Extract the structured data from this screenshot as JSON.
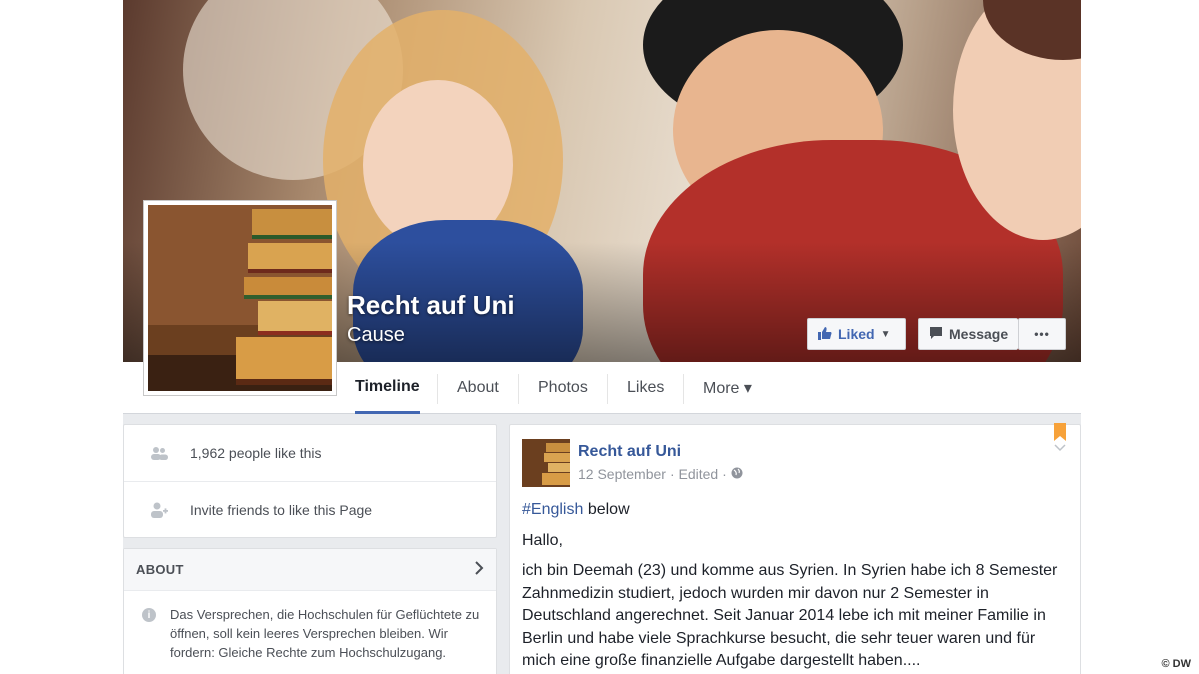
{
  "page": {
    "name": "Recht auf Uni",
    "category": "Cause"
  },
  "cover_actions": {
    "liked_label": "Liked",
    "message_label": "Message",
    "more_label": "•••"
  },
  "tabs": [
    {
      "label": "Timeline",
      "active": true
    },
    {
      "label": "About"
    },
    {
      "label": "Photos"
    },
    {
      "label": "Likes"
    },
    {
      "label": "More ▾"
    }
  ],
  "sidebar": {
    "likes_count": "1,962 people like this",
    "invite_text": "Invite friends to like this Page",
    "about_heading": "ABOUT",
    "about_text": "Das Versprechen, die Hochschulen für Geflüchtete zu öffnen, soll kein leeres Versprechen bleiben. Wir fordern: Gleiche Rechte zum Hochschulzugang."
  },
  "post": {
    "author": "Recht auf Uni",
    "date": "12 September",
    "edited": "· Edited ·",
    "hashtag": "#English",
    "hashtag_suffix": " below",
    "greeting": "Hallo,",
    "text": "ich bin Deemah (23) und komme aus Syrien. In Syrien habe ich 8 Semester Zahnmedizin studiert, jedoch wurden mir davon nur 2 Semester in Deutschland angerechnet. Seit Januar 2014 lebe ich mit meiner Familie in Berlin und habe viele Sprachkurse besucht, die sehr teuer waren und für mich eine große finanzielle Aufgabe dargestellt haben...."
  },
  "watermark": "© DW",
  "colors": {
    "brand_blue": "#4267b2",
    "link_blue": "#365899",
    "background": "#e9ebee"
  }
}
